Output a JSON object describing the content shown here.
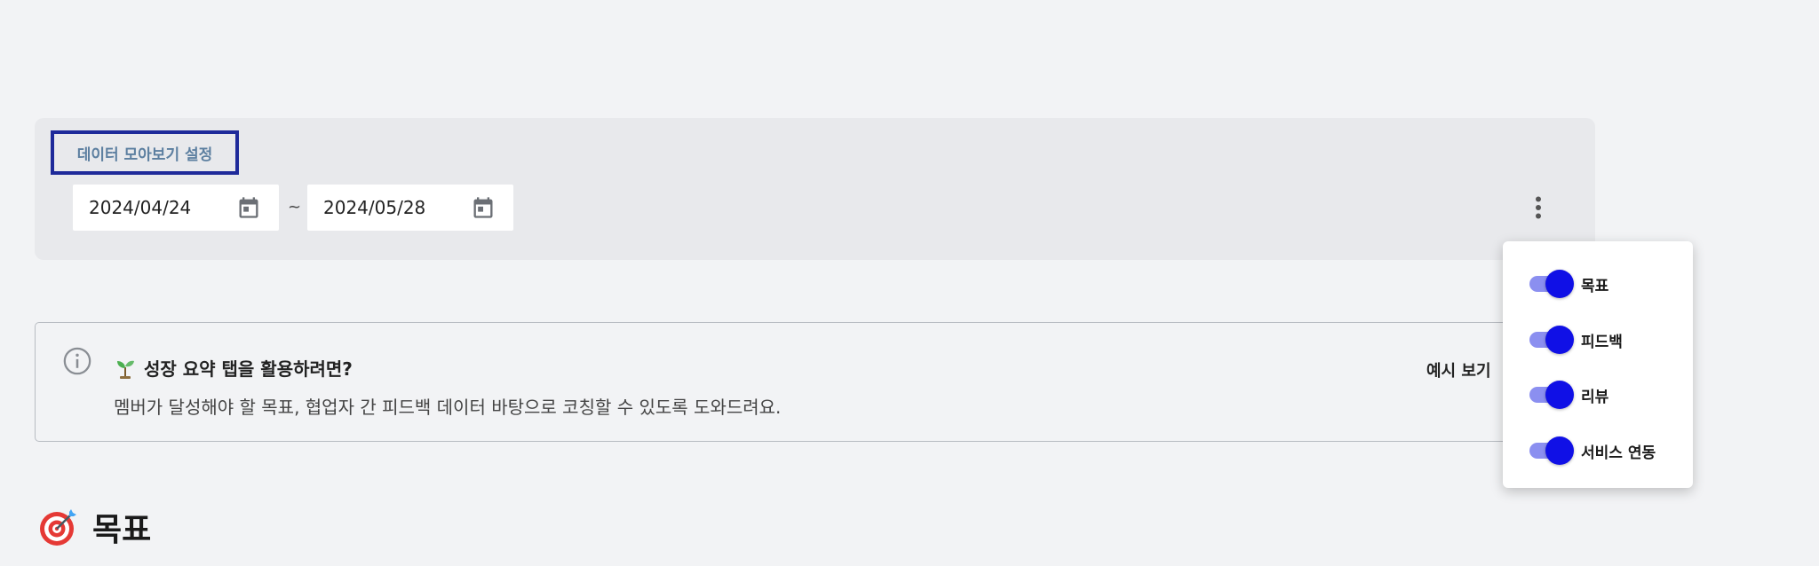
{
  "settings": {
    "title": "데이터 모아보기 설정",
    "start_date": "2024/04/24",
    "end_date": "2024/05/28",
    "separator": "~"
  },
  "info": {
    "title": "성장 요약 탭을 활용하려면?",
    "description": "멤버가 달성해야 할 목표, 협업자 간 피드백 데이터 바탕으로 코칭할 수 있도록 도와드려요.",
    "example_link": "예시 보기"
  },
  "section": {
    "heading": "목표"
  },
  "toggle_menu": {
    "items": [
      {
        "label": "목표",
        "enabled": true
      },
      {
        "label": "피드백",
        "enabled": true
      },
      {
        "label": "리뷰",
        "enabled": true
      },
      {
        "label": "서비스 연동",
        "enabled": true
      }
    ]
  },
  "colors": {
    "accent": "#1010e6",
    "track": "#8b8ff0",
    "highlight_border": "#1e2a9a",
    "settings_title": "#5c7fa0"
  },
  "icons": [
    "calendar-icon",
    "more-vertical-icon",
    "info-icon",
    "sprout-icon",
    "target-icon"
  ]
}
